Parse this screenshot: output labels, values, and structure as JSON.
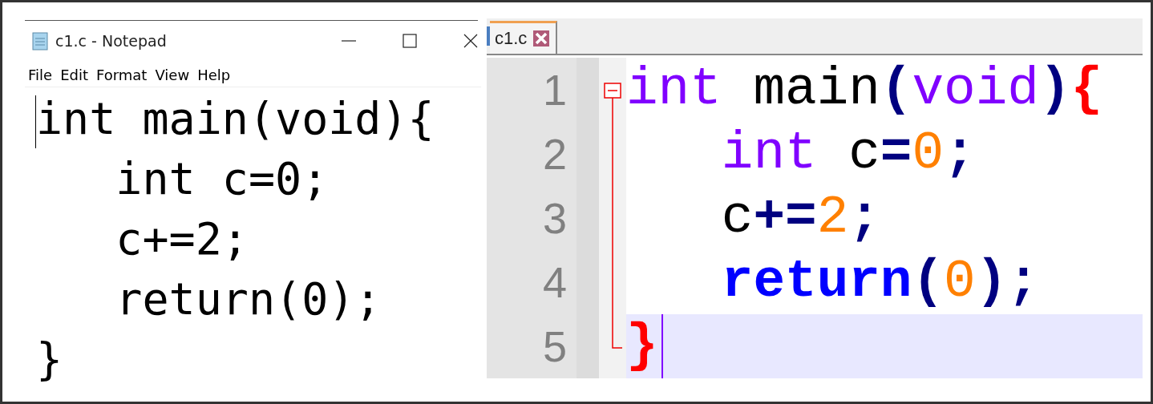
{
  "notepad": {
    "title": "c1.c - Notepad",
    "menu": [
      "File",
      "Edit",
      "Format",
      "View",
      "Help"
    ],
    "lines": [
      "int main(void){",
      "   int c=0;",
      "   c+=2;",
      "   return(0);",
      "}"
    ]
  },
  "editor": {
    "tabs": [
      {
        "label": "c1.c",
        "selected": true
      }
    ],
    "lines": [
      {
        "number": "1",
        "current": false,
        "indented": false,
        "tokens": [
          {
            "kind": "type",
            "text": "int"
          },
          {
            "kind": "plain",
            "text": " main"
          },
          {
            "kind": "operator",
            "text": "("
          },
          {
            "kind": "type",
            "text": "void"
          },
          {
            "kind": "operator",
            "text": ")"
          },
          {
            "kind": "brace-match",
            "text": "{"
          }
        ]
      },
      {
        "number": "2",
        "current": false,
        "indented": true,
        "tokens": [
          {
            "kind": "type",
            "text": "int"
          },
          {
            "kind": "plain",
            "text": " c"
          },
          {
            "kind": "operator",
            "text": "="
          },
          {
            "kind": "number",
            "text": "0"
          },
          {
            "kind": "operator",
            "text": ";"
          }
        ]
      },
      {
        "number": "3",
        "current": false,
        "indented": true,
        "tokens": [
          {
            "kind": "plain",
            "text": "c"
          },
          {
            "kind": "operator",
            "text": "+="
          },
          {
            "kind": "number",
            "text": "2"
          },
          {
            "kind": "operator",
            "text": ";"
          }
        ]
      },
      {
        "number": "4",
        "current": false,
        "indented": true,
        "tokens": [
          {
            "kind": "keyword",
            "text": "return"
          },
          {
            "kind": "operator",
            "text": "("
          },
          {
            "kind": "number",
            "text": "0"
          },
          {
            "kind": "operator",
            "text": ")"
          },
          {
            "kind": "operator",
            "text": ";"
          }
        ]
      },
      {
        "number": "5",
        "current": true,
        "indented": false,
        "tokens": [
          {
            "kind": "brace-match",
            "text": "}"
          }
        ]
      }
    ]
  }
}
